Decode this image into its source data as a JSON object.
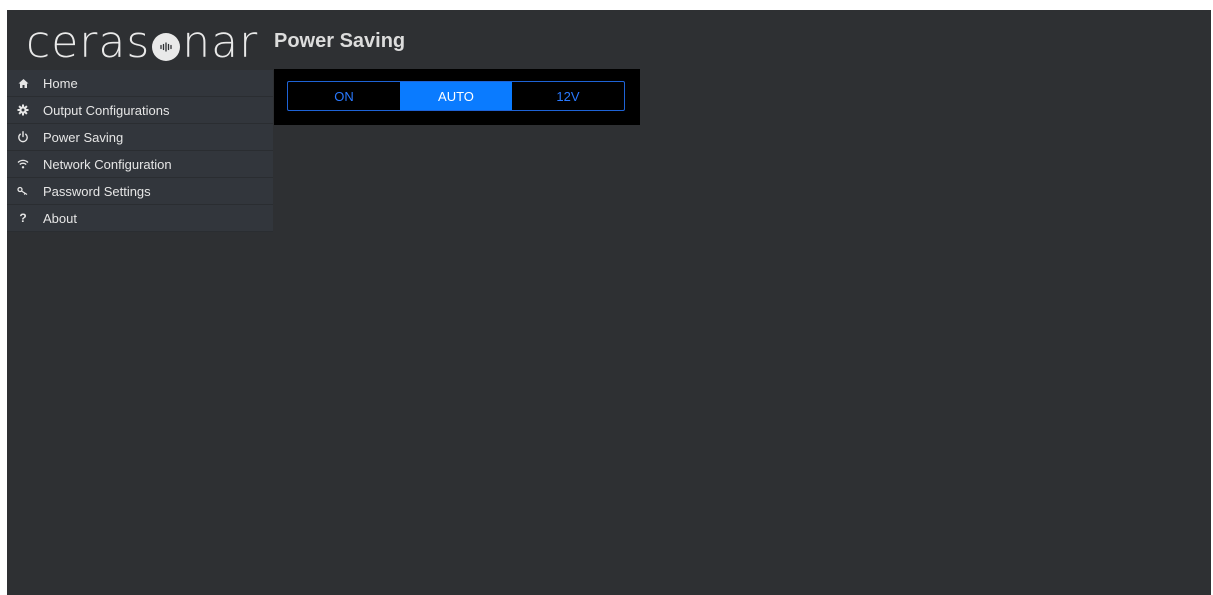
{
  "brand": {
    "logo_left": "ceras",
    "logo_right": "nar",
    "logo_mark_icon": "speaker-wave-icon"
  },
  "header": {
    "title": "Power Saving"
  },
  "sidebar": {
    "items": [
      {
        "label": "Home",
        "icon": "home-icon"
      },
      {
        "label": "Output Configurations",
        "icon": "gear-icon"
      },
      {
        "label": "Power Saving",
        "icon": "power-icon"
      },
      {
        "label": "Network Configuration",
        "icon": "wifi-icon"
      },
      {
        "label": "Password Settings",
        "icon": "key-icon"
      },
      {
        "label": "About",
        "icon": "question-icon"
      }
    ]
  },
  "power_mode": {
    "options": [
      "ON",
      "AUTO",
      "12V"
    ],
    "selected": "AUTO"
  },
  "colors": {
    "background": "#2e3033",
    "sidebar": "#32363c",
    "accent": "#0a7bff",
    "panel": "#000000"
  }
}
